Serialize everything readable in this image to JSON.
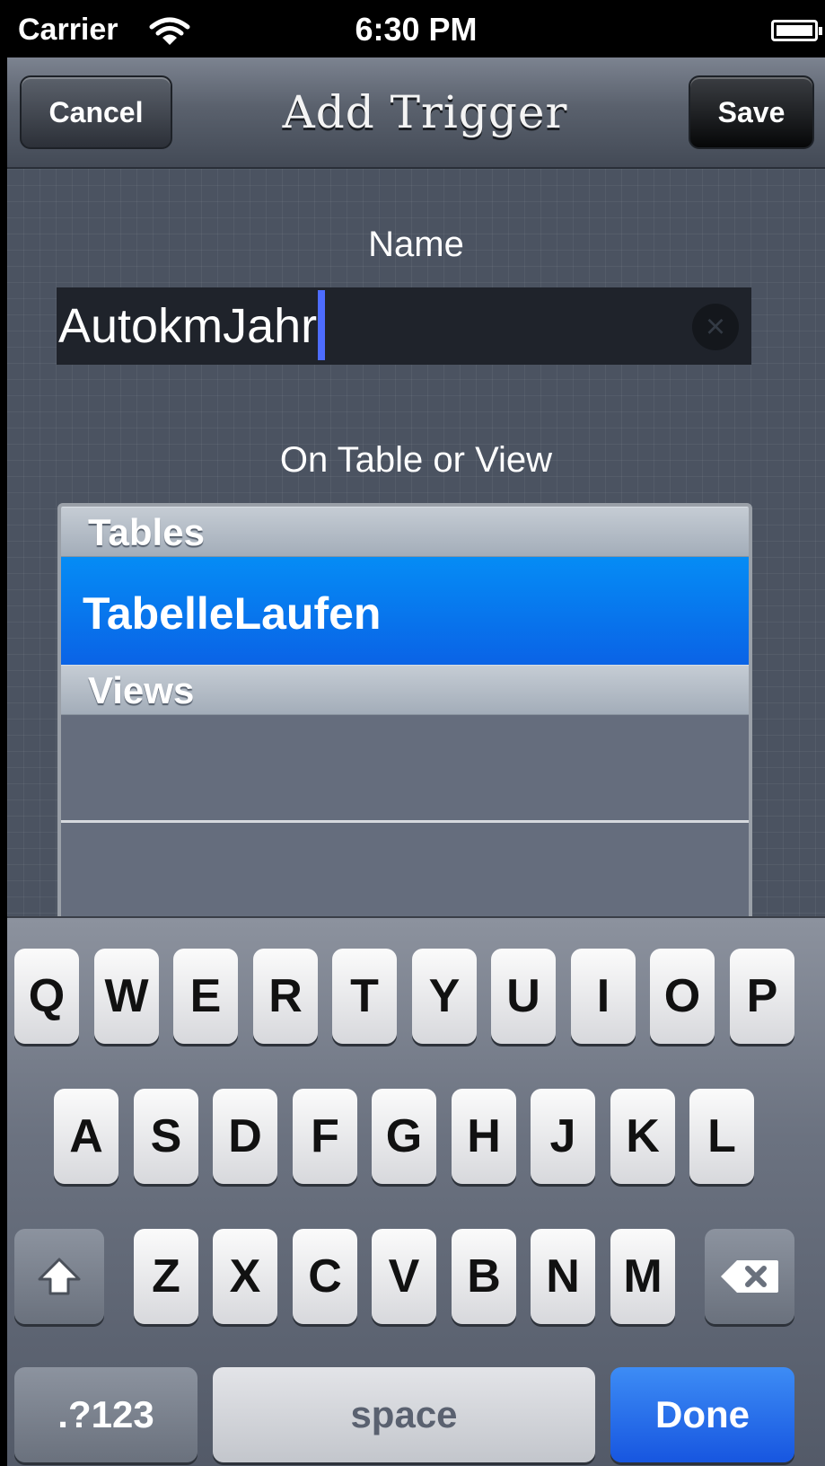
{
  "status_bar": {
    "carrier": "Carrier",
    "time": "6:30 PM"
  },
  "nav": {
    "cancel_label": "Cancel",
    "title": "Add Trigger",
    "save_label": "Save"
  },
  "form": {
    "name_label": "Name",
    "name_value": "AutokmJahr",
    "on_label": "On Table or View"
  },
  "picker": {
    "sections": [
      {
        "header": "Tables",
        "items": [
          {
            "label": "TabelleLaufen",
            "selected": true
          }
        ]
      },
      {
        "header": "Views",
        "items": []
      }
    ]
  },
  "keyboard": {
    "row1": [
      "Q",
      "W",
      "E",
      "R",
      "T",
      "Y",
      "U",
      "I",
      "O",
      "P"
    ],
    "row2": [
      "A",
      "S",
      "D",
      "F",
      "G",
      "H",
      "J",
      "K",
      "L"
    ],
    "row3": [
      "Z",
      "X",
      "C",
      "V",
      "B",
      "N",
      "M"
    ],
    "numbers_label": ".?123",
    "space_label": "space",
    "done_label": "Done"
  },
  "colors": {
    "selection_blue": "#0a7cf0",
    "done_blue": "#1f6ae8",
    "cursor_blue": "#4d6cff"
  }
}
